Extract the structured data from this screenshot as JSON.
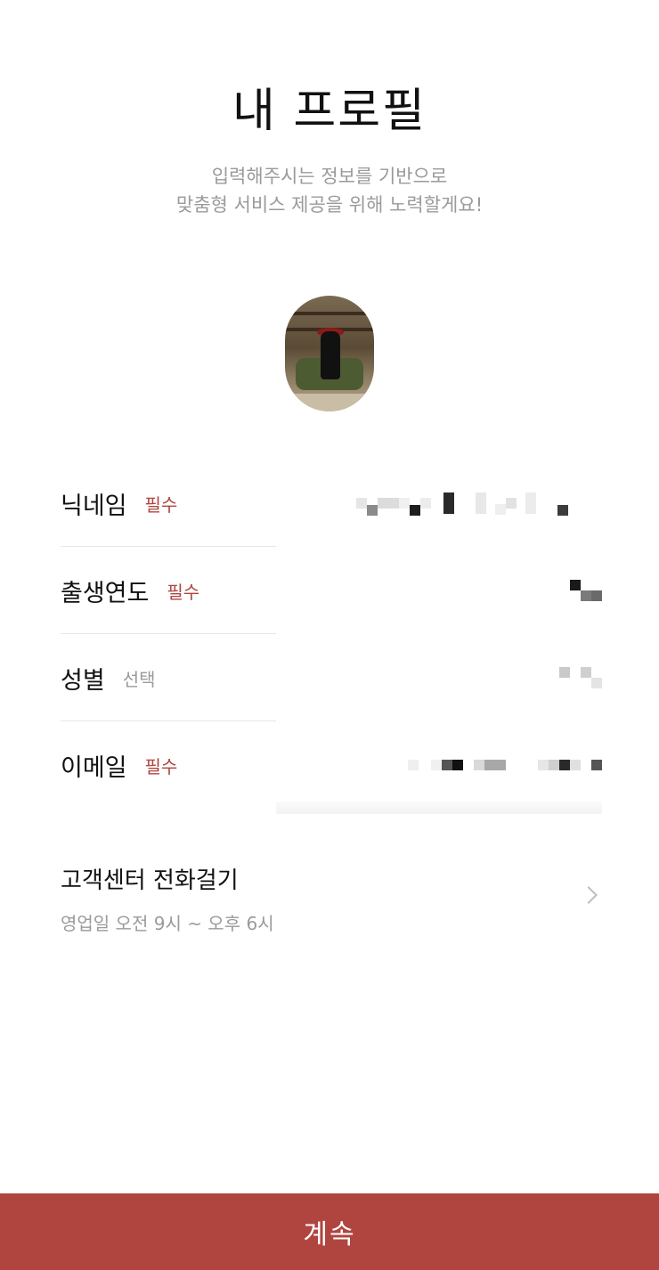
{
  "header": {
    "title": "내 프로필",
    "subtitle_line1": "입력해주시는 정보를 기반으로",
    "subtitle_line2": "맞춤형 서비스 제공을 위해 노력할게요!"
  },
  "profile": {
    "avatar": "profile-photo"
  },
  "fields": [
    {
      "label": "닉네임",
      "tag": "필수"
    },
    {
      "label": "출생연도",
      "tag": "필수"
    },
    {
      "label": "성별",
      "tag": "선택"
    },
    {
      "label": "이메일",
      "tag": "필수"
    }
  ],
  "support": {
    "title": "고객센터 전화걸기",
    "hours": "영업일 오전 9시 ~ 오후 6시",
    "icon": "chevron-right-icon"
  },
  "footer": {
    "continue_label": "계속"
  },
  "colors": {
    "accent": "#b0453f",
    "muted": "#9a9a9a",
    "divider": "#e6e6e6"
  }
}
